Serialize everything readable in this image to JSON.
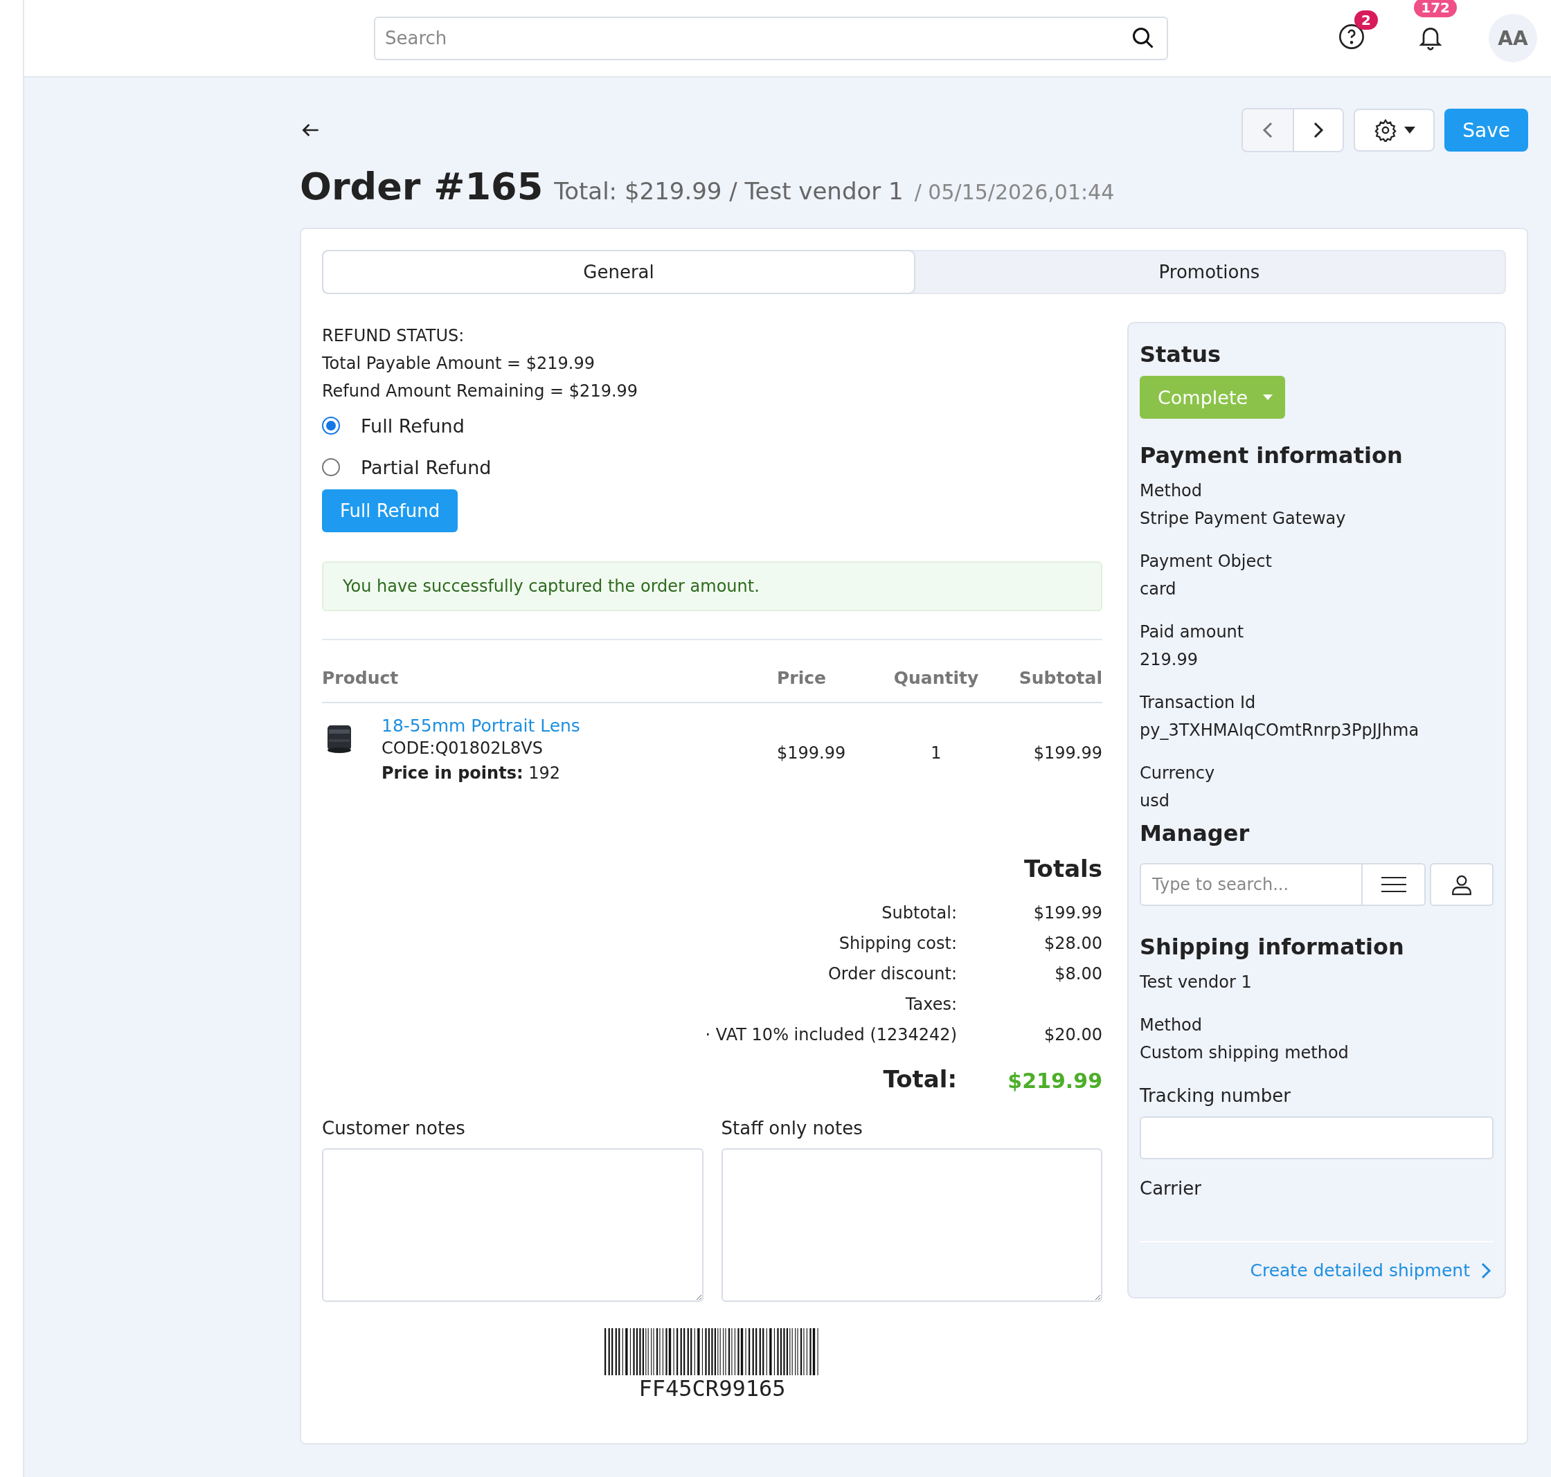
{
  "topbar": {
    "search": {
      "placeholder": "Search"
    },
    "help_badge": "2",
    "notifications_badge": "172",
    "avatar": "AA"
  },
  "toolbar": {
    "save": "Save"
  },
  "order": {
    "title": "Order #165",
    "summary": "Total: $219.99 / Test vendor 1",
    "date": "/ 05/15/2026,01:44"
  },
  "tabs": [
    {
      "label": "General",
      "selected": true
    },
    {
      "label": "Promotions",
      "selected": false
    }
  ],
  "refund": {
    "heading": "REFUND STATUS:",
    "lines": [
      "Total Payable Amount = $219.99",
      "Refund Amount Remaining = $219.99"
    ],
    "options": [
      {
        "label": "Full Refund",
        "selected": true
      },
      {
        "label": "Partial Refund",
        "selected": false
      }
    ],
    "button": "Full Refund"
  },
  "alert": "You have successfully captured the order amount.",
  "products": {
    "columns": [
      "Product",
      "Price",
      "Quantity",
      "Subtotal"
    ],
    "rows": [
      {
        "name": "18-55mm Portrait Lens",
        "code": "CODE:Q01802L8VS",
        "points": "**Price in points:** 192",
        "price": "$199.99",
        "quantity": "1",
        "subtotal": "$199.99"
      }
    ]
  },
  "totals": {
    "heading": "Totals",
    "rows": [
      {
        "kind": "line",
        "label": "Subtotal:",
        "value": "$199.99"
      },
      {
        "kind": "line",
        "label": "Shipping cost:",
        "value": "$28.00"
      },
      {
        "kind": "line",
        "label": "Order discount:",
        "value": "$8.00"
      },
      {
        "kind": "line",
        "label": "Taxes:"
      },
      {
        "kind": "line",
        "label": "· VAT 10% included (1234242)",
        "value": "$20.00"
      },
      {
        "kind": "total",
        "label": "Total:",
        "value": "$219.99"
      }
    ]
  },
  "notes": [
    {
      "label": "Customer notes"
    },
    {
      "label": "Staff only notes"
    }
  ],
  "barcode": "FF45CR99165",
  "sidebar": {
    "status": {
      "heading": "Status",
      "value": "Complete"
    },
    "payment": {
      "heading": "Payment information",
      "fields": [
        {
          "label": "Method",
          "value": "Stripe Payment Gateway"
        },
        {
          "label": "Payment Object",
          "value": "card"
        },
        {
          "label": "Paid amount",
          "value": "219.99"
        },
        {
          "label": "Transaction Id",
          "value": "py_3TXHMAIqCOmtRnrp3PpJJhma"
        },
        {
          "label": "Currency",
          "value": "usd"
        }
      ]
    },
    "manager": {
      "heading": "Manager",
      "placeholder": "Type to search..."
    },
    "shipping": {
      "heading": "Shipping information",
      "vendor": "Test vendor 1",
      "method_label": "Method",
      "method": "Custom shipping method",
      "tracking_label": "Tracking number",
      "carrier_label": "Carrier",
      "link": "Create detailed shipment"
    }
  }
}
